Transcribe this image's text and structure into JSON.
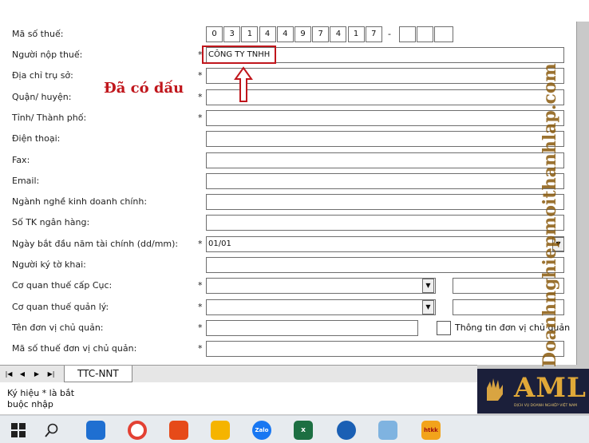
{
  "form": {
    "tax_code_label": "Mã số thuế:",
    "tax_digits": [
      "0",
      "3",
      "1",
      "4",
      "4",
      "9",
      "7",
      "4",
      "1",
      "7"
    ],
    "tax_separator": "-",
    "tax_suffix_boxes": 3,
    "fields": [
      {
        "label": "Người nộp thuế:",
        "required": true,
        "value": "CÔNG TY TNHH"
      },
      {
        "label": "Địa chỉ trụ sở:",
        "required": true,
        "value": ""
      },
      {
        "label": "Quận/ huyện:",
        "required": true,
        "value": ""
      },
      {
        "label": "Tỉnh/ Thành phố:",
        "required": true,
        "value": ""
      },
      {
        "label": "Điện thoại:",
        "required": false,
        "value": ""
      },
      {
        "label": "Fax:",
        "required": false,
        "value": ""
      },
      {
        "label": "Email:",
        "required": false,
        "value": ""
      },
      {
        "label": "Ngành nghề kinh doanh chính:",
        "required": false,
        "value": ""
      },
      {
        "label": "Số TK ngân hàng:",
        "required": false,
        "value": ""
      },
      {
        "label": "Ngày bắt đầu năm tài chính (dd/mm):",
        "required": true,
        "value": "01/01"
      },
      {
        "label": "Người ký tờ khai:",
        "required": false,
        "value": ""
      },
      {
        "label": "Cơ quan thuế cấp Cục:",
        "required": true,
        "value": ""
      },
      {
        "label": "Cơ quan thuế quản lý:",
        "required": true,
        "value": ""
      },
      {
        "label": "Tên đơn vị chủ quản:",
        "required": true,
        "value": ""
      },
      {
        "label": "Mã số thuế đơn vị chủ quản:",
        "required": true,
        "value": ""
      }
    ],
    "required_mark": "*",
    "checkbox_label": "Thông tin đơn vị chủ quản"
  },
  "annotation": {
    "text": "Đã có dấu",
    "color": "#c0161c"
  },
  "sheet": {
    "tab": "TTC-NNT",
    "nav": [
      "|◀",
      "◀",
      "▶",
      "▶|"
    ]
  },
  "note": {
    "line1": "Ký hiệu * là bắt",
    "line2": "buộc nhập"
  },
  "watermark": "Doanhnghiepmoithanhlap.com",
  "brand": {
    "name": "AML",
    "tagline": "DỊCH VỤ DOANH NGHIỆP VIỆT NAM"
  },
  "taskbar": {
    "items": [
      {
        "icon": "windows-start-icon",
        "label": ""
      },
      {
        "icon": "search-icon",
        "label": ""
      },
      {
        "icon": "calculator-app-icon",
        "label": ""
      },
      {
        "icon": "chrome-icon",
        "label": ""
      },
      {
        "icon": "office-icon",
        "label": ""
      },
      {
        "icon": "file-explorer-icon",
        "label": ""
      },
      {
        "icon": "zalo-icon",
        "label": "Zalo"
      },
      {
        "icon": "excel-icon",
        "label": "x"
      },
      {
        "icon": "mail-app-icon",
        "label": ""
      },
      {
        "icon": "notes-app-icon",
        "label": ""
      },
      {
        "icon": "htkk-app-icon",
        "label": "htkk"
      }
    ]
  }
}
